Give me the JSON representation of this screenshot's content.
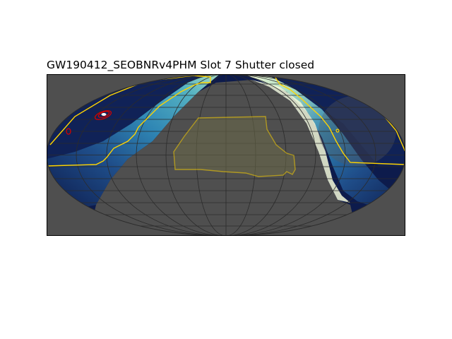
{
  "title": "GW190412_SEOBNRv4PHM Slot 7 Shutter closed",
  "projection": "Mollweide (all-sky)",
  "colors": {
    "background": "#4f4f4f",
    "graticule": "#2b2b2b",
    "footprint_outline": "#ffd400",
    "localization_contour": "#d40000",
    "sky_colormap": [
      "#0d1b4c",
      "#1f4e8a",
      "#2f86b4",
      "#56b3c2",
      "#a9dcc2",
      "#f6f9d8"
    ]
  },
  "overlays": {
    "footprint": "yellow outlined region",
    "localization": "red probability contours",
    "sky_band": "colormapped sky brightness band (galactic plane)"
  }
}
